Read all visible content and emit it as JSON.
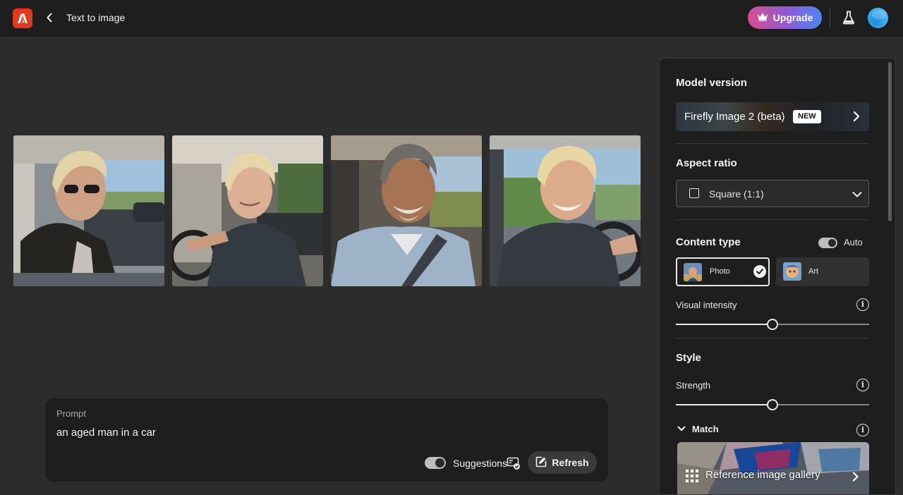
{
  "header": {
    "app_icon": "adobe-firefly-icon",
    "title": "Text to image",
    "upgrade_label": "Upgrade",
    "upgrade_icon": "crown-icon",
    "labs_icon": "flask-icon"
  },
  "images": [
    {
      "name": "man with sunglasses in car"
    },
    {
      "name": "blond man driving car"
    },
    {
      "name": "smiling gray-haired man in car"
    },
    {
      "name": "smiling blond man at wheel"
    }
  ],
  "prompt": {
    "label": "Prompt",
    "text": "an aged man in a car",
    "suggestions_label": "Suggestions",
    "suggestions_on": true,
    "refresh_label": "Refresh"
  },
  "panel": {
    "model": {
      "title": "Model version",
      "value": "Firefly Image 2 (beta)",
      "badge": "NEW"
    },
    "aspect": {
      "title": "Aspect ratio",
      "value": "Square (1:1)"
    },
    "content_type": {
      "title": "Content type",
      "auto_label": "Auto",
      "auto_on": true,
      "options": [
        "Photo",
        "Art"
      ],
      "selected": "Photo"
    },
    "visual_intensity": {
      "label": "Visual intensity",
      "value": 0.5
    },
    "style": {
      "title": "Style",
      "strength_label": "Strength",
      "strength_value": 0.5,
      "match_label": "Match",
      "gallery_label": "Reference image gallery"
    }
  },
  "colors": {
    "background": "#2c2c2c",
    "header": "#1e1e1e",
    "panel": "#1e1e1e",
    "accent_red": "#e3391f"
  }
}
